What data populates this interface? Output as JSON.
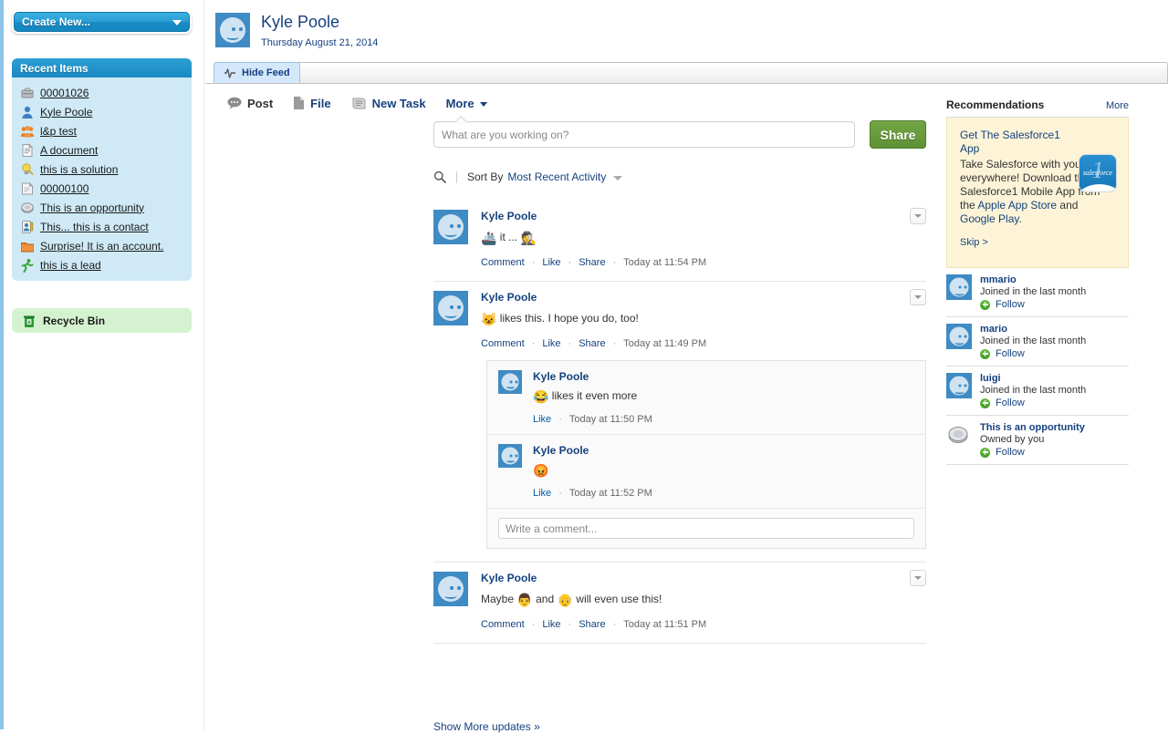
{
  "sidebar": {
    "create_new_label": "Create New...",
    "recent_items_title": "Recent Items",
    "recent_items": [
      {
        "label": "00001026",
        "icon": "case-icon"
      },
      {
        "label": "Kyle Poole",
        "icon": "user-icon"
      },
      {
        "label": "l&p test",
        "icon": "campaign-icon"
      },
      {
        "label": "A document",
        "icon": "document-icon"
      },
      {
        "label": "this is a solution",
        "icon": "lightbulb-icon"
      },
      {
        "label": "00000100",
        "icon": "note-icon"
      },
      {
        "label": "This is an opportunity",
        "icon": "opportunity-icon"
      },
      {
        "label": "This... this is a contact",
        "icon": "contact-icon"
      },
      {
        "label": "Surprise! It is an account.",
        "icon": "account-icon"
      },
      {
        "label": "this is a lead",
        "icon": "lead-icon"
      }
    ],
    "recycle_bin_label": "Recycle Bin"
  },
  "header": {
    "profile_name": "Kyle Poole",
    "profile_date": "Thursday August 21, 2014",
    "avatar_icon": "smiley-avatar-icon"
  },
  "tabs": {
    "hide_feed_label": "Hide Feed",
    "hide_feed_icon": "pulse-icon"
  },
  "publisher": {
    "actions": [
      {
        "label": "Post",
        "icon": "chat-bubble-icon",
        "active": true
      },
      {
        "label": "File",
        "icon": "file-icon",
        "active": false
      },
      {
        "label": "New Task",
        "icon": "task-list-icon",
        "active": false
      }
    ],
    "more_label": "More",
    "input_placeholder": "What are you working on?",
    "input_value": "",
    "share_label": "Share"
  },
  "sortbar": {
    "search_icon": "search-icon",
    "sort_by_label": "Sort By",
    "sort_value": "Most Recent Activity"
  },
  "feed": {
    "comment_label": "Comment",
    "like_label": "Like",
    "share_label": "Share",
    "dot": "·",
    "comment_placeholder": "Write a comment...",
    "show_more_label": "Show More updates »",
    "posts": [
      {
        "author": "Kyle Poole",
        "text_pre": "",
        "emoji1": "🚢",
        "text_mid": " it ... ",
        "emoji2": "🕵️",
        "text_post": "",
        "timestamp": "Today at 11:54 PM",
        "comments": []
      },
      {
        "author": "Kyle Poole",
        "text_pre": "",
        "emoji1": "😺",
        "text_mid": " likes this. I hope you do, too!",
        "emoji2": "",
        "text_post": "",
        "timestamp": "Today at 11:49 PM",
        "comments": [
          {
            "author": "Kyle Poole",
            "emoji1": "😂",
            "text_mid": " likes it even more",
            "timestamp": "Today at 11:50 PM"
          },
          {
            "author": "Kyle Poole",
            "emoji1": "😡",
            "text_mid": "",
            "timestamp": "Today at 11:52 PM"
          }
        ]
      },
      {
        "author": "Kyle Poole",
        "text_pre": "Maybe ",
        "emoji1": "👨",
        "text_mid": " and ",
        "emoji2": "👴",
        "text_post": " will even use this!",
        "timestamp": "Today at 11:51 PM",
        "comments": []
      }
    ]
  },
  "recommendations": {
    "title": "Recommendations",
    "more_label": "More",
    "card": {
      "link_text": "Get The Salesforce1 App",
      "desc_part1": "Take Salesforce with you everywhere! Download the new Salesforce1 Mobile App from the ",
      "link_apple": "Apple App Store",
      "desc_and": " and ",
      "link_google": "Google Play",
      "desc_end": ".",
      "skip_label": "Skip >",
      "icon_word": "salesforce",
      "icon_numeral": "1"
    },
    "items": [
      {
        "name": "mmario",
        "sub": "Joined in the last month",
        "follow_label": "Follow",
        "icon": "smiley-avatar-icon"
      },
      {
        "name": "mario",
        "sub": "Joined in the last month",
        "follow_label": "Follow",
        "icon": "smiley-avatar-icon"
      },
      {
        "name": "luigi",
        "sub": "Joined in the last month",
        "follow_label": "Follow",
        "icon": "smiley-avatar-icon"
      },
      {
        "name": "This is an opportunity",
        "sub": "Owned by you",
        "follow_label": "Follow",
        "icon": "opportunity-icon"
      }
    ]
  },
  "colors": {
    "link_blue": "#15417e",
    "header_blue": "#1b8ac2",
    "share_green": "#5f9236",
    "recent_bg": "#cfeaf6",
    "recycle_bg": "#d5f2d0",
    "rec_card_bg": "#fdf4d8",
    "avatar_blue": "#3f8bc4"
  }
}
